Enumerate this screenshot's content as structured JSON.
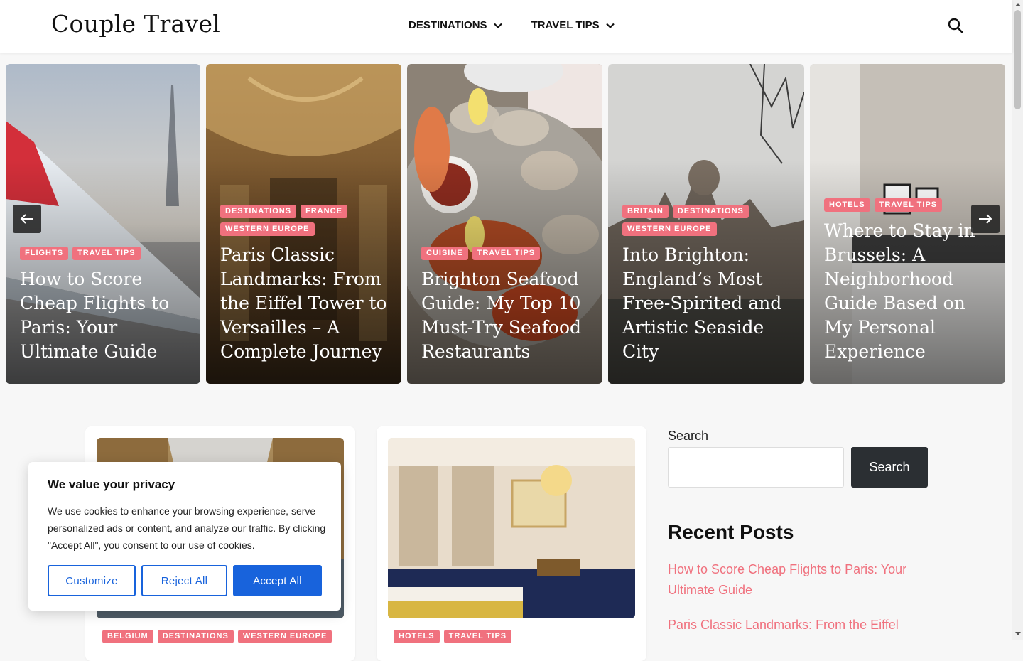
{
  "header": {
    "logo": "Couple Travel",
    "nav": [
      {
        "label": "DESTINATIONS"
      },
      {
        "label": "TRAVEL TIPS"
      }
    ]
  },
  "slider": {
    "slides": [
      {
        "tags": [
          "FLIGHTS",
          "TRAVEL TIPS"
        ],
        "title": "How to Score Cheap Flights to Paris: Your Ultimate Guide"
      },
      {
        "tags": [
          "DESTINATIONS",
          "FRANCE",
          "WESTERN EUROPE"
        ],
        "title": "Paris Classic Landmarks: From the Eiffel Tower to Versailles – A Complete Journey"
      },
      {
        "tags": [
          "CUISINE",
          "TRAVEL TIPS"
        ],
        "title": "Brighton Seafood Guide: My Top 10 Must-Try Seafood Restaurants"
      },
      {
        "tags": [
          "BRITAIN",
          "DESTINATIONS",
          "WESTERN EUROPE"
        ],
        "title": "Into Brighton: England’s Most Free-Spirited and Artistic Seaside City"
      },
      {
        "tags": [
          "HOTELS",
          "TRAVEL TIPS"
        ],
        "title": "Where to Stay in Brussels: A Neighborhood Guide Based on My Personal Experience"
      }
    ]
  },
  "cards": [
    {
      "tags": [
        "BELGIUM",
        "DESTINATIONS",
        "WESTERN EUROPE"
      ]
    },
    {
      "tags": [
        "HOTELS",
        "TRAVEL TIPS"
      ]
    }
  ],
  "sidebar": {
    "search_label": "Search",
    "search_button": "Search",
    "recent_title": "Recent Posts",
    "recent_posts": [
      "How to Score Cheap Flights to Paris: Your Ultimate Guide",
      "Paris Classic Landmarks: From the Eiffel"
    ]
  },
  "cookie": {
    "title": "We value your privacy",
    "text": "We use cookies to enhance your browsing experience, serve personalized ads or content, and analyze our traffic. By clicking \"Accept All\", you consent to our use of cookies.",
    "customize": "Customize",
    "reject": "Reject All",
    "accept": "Accept All"
  },
  "colors": {
    "accent": "#f0717e",
    "cookie_blue": "#1863dc",
    "dark_button": "#2b2f33"
  }
}
